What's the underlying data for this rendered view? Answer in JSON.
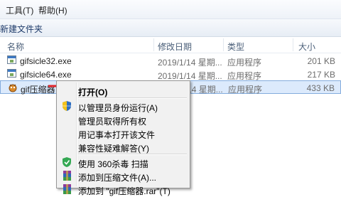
{
  "menubar": {
    "tools": "工具(T)",
    "help": "帮助(H)"
  },
  "toolbar": {
    "new_folder": "新建文件夹"
  },
  "columns": {
    "name": "名称",
    "date": "修改日期",
    "type": "类型",
    "size": "大小"
  },
  "files": [
    {
      "name": "gifsicle32.exe",
      "date": "2019/1/14 星期...",
      "type": "应用程序",
      "size": "201 KB"
    },
    {
      "name": "gifsicle64.exe",
      "date": "2019/1/14 星期...",
      "type": "应用程序",
      "size": "217 KB"
    },
    {
      "name": "gif压缩器",
      "date": "2019/1/14 星期...",
      "type": "应用程序",
      "size": "433 KB"
    }
  ],
  "context_menu": {
    "items": [
      {
        "label": "打开(O)",
        "icon": "none"
      },
      {
        "label": "以管理员身份运行(A)",
        "icon": "uac-shield-icon"
      },
      {
        "label": "管理员取得所有权",
        "icon": "none"
      },
      {
        "label": "用记事本打开该文件",
        "icon": "none"
      },
      {
        "label": "兼容性疑难解答(Y)",
        "icon": "none"
      },
      {
        "label": "使用 360杀毒 扫描",
        "icon": "360-shield-icon"
      },
      {
        "label": "添加到压缩文件(A)...",
        "icon": "winrar-icon"
      },
      {
        "label": "添加到 \"gif压缩器.rar\"(T)",
        "icon": "winrar-icon"
      }
    ]
  },
  "colors": {
    "selection": "#dceafc",
    "arrow": "#e0242a"
  }
}
